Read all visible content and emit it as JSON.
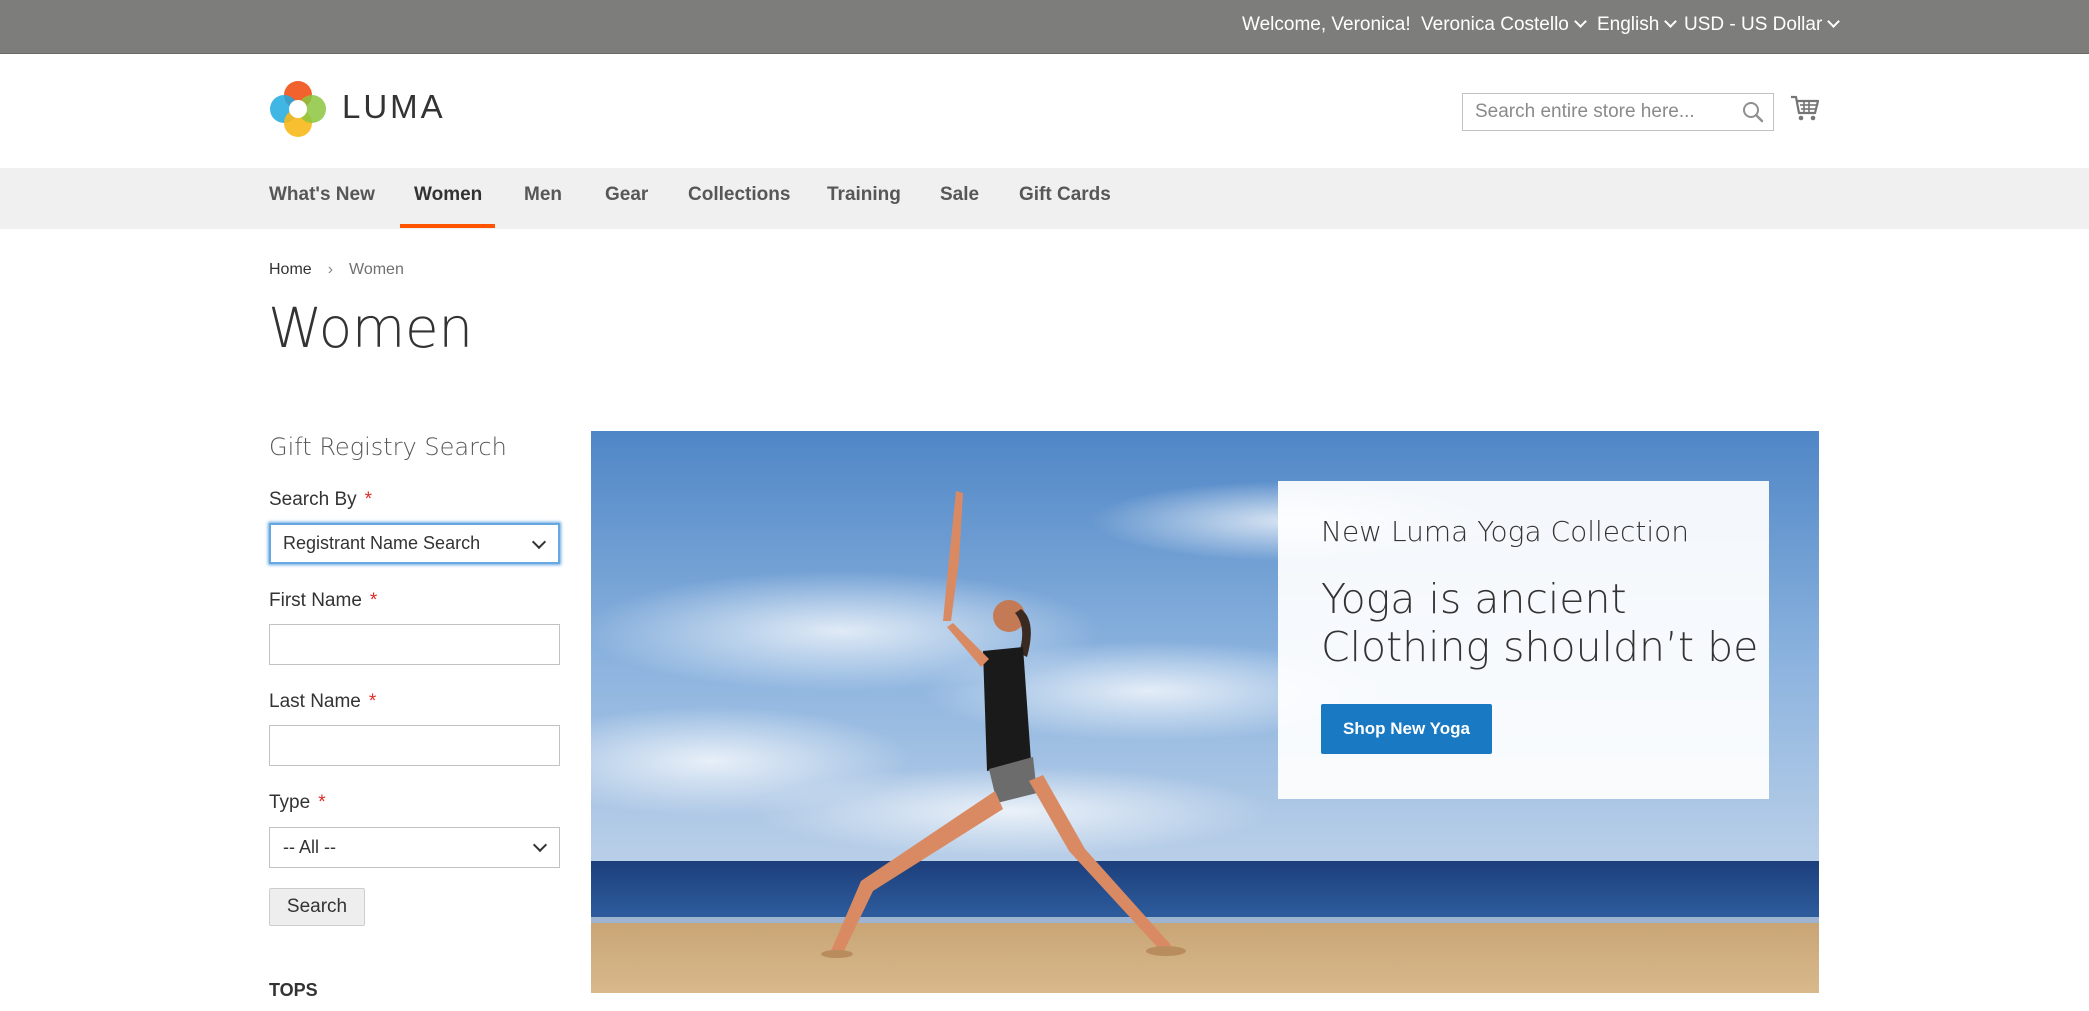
{
  "top_bar": {
    "welcome": "Welcome, Veronica!",
    "account_name": "Veronica Costello",
    "language": "English",
    "currency": "USD - US Dollar"
  },
  "header": {
    "logo_text": "LUMA",
    "search_placeholder": "Search entire store here...",
    "search_icon": "search-icon",
    "cart_icon": "cart-icon"
  },
  "nav": {
    "items": [
      "What's New",
      "Women",
      "Men",
      "Gear",
      "Collections",
      "Training",
      "Sale",
      "Gift Cards"
    ],
    "active": "Women"
  },
  "breadcrumb": {
    "home": "Home",
    "current": "Women"
  },
  "page_title": "Women",
  "gift_registry": {
    "title": "Gift Registry Search",
    "search_by_label": "Search By",
    "search_by_value": "Registrant Name Search",
    "first_name_label": "First Name",
    "first_name_value": "",
    "last_name_label": "Last Name",
    "last_name_value": "",
    "type_label": "Type",
    "type_value": "-- All --",
    "required_mark": "*",
    "search_button": "Search"
  },
  "sidebar": {
    "tops_heading": "TOPS"
  },
  "promo": {
    "subtitle": "New Luma Yoga Collection",
    "headline_line1": "Yoga is ancient",
    "headline_line2": "Clothing shouldn’t be",
    "button": "Shop New Yoga"
  },
  "colors": {
    "top_bar_bg": "#7d7d7b",
    "nav_bg": "#f0f0f0",
    "nav_active_underline": "#ff5501",
    "primary_button": "#1979c3",
    "required": "#e02b27"
  }
}
